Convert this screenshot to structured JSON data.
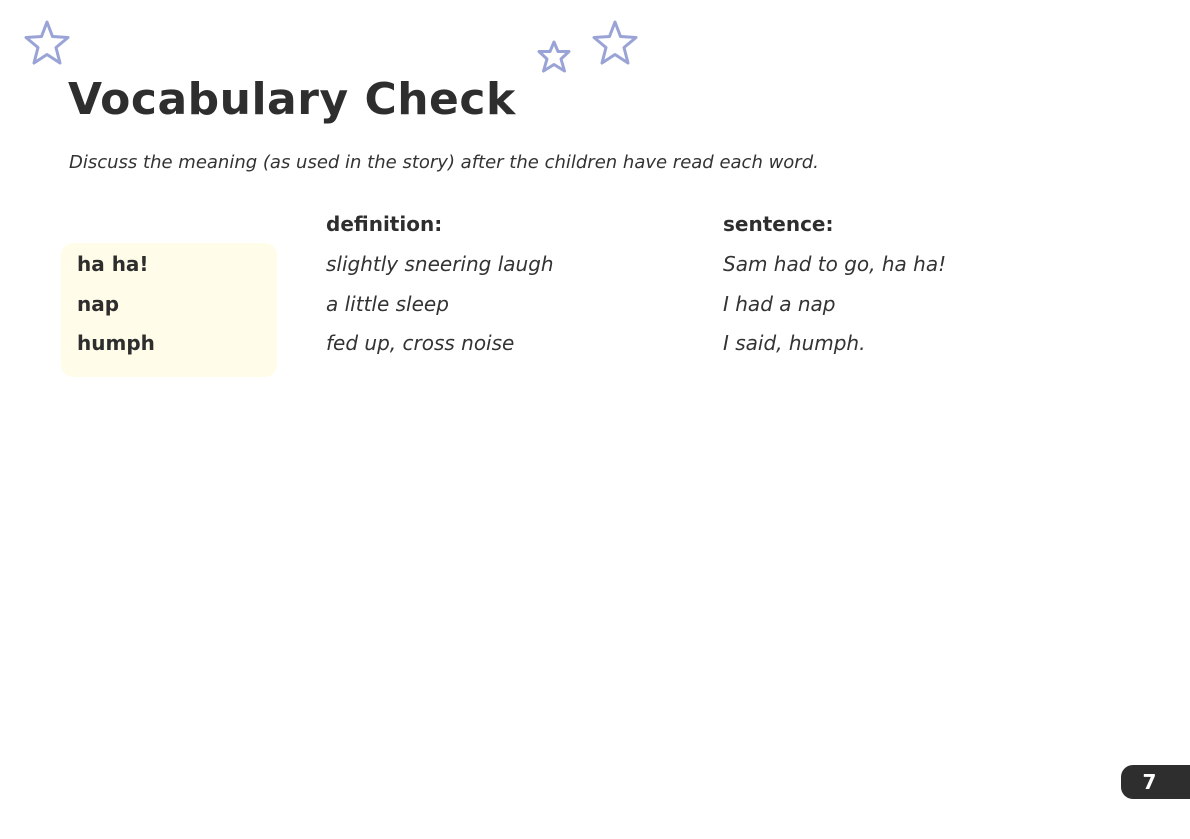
{
  "decorations": {
    "stars": [
      "star-icon",
      "star-icon",
      "star-icon"
    ],
    "star_color": "#9aa3d6"
  },
  "page": {
    "title": "Vocabulary Check",
    "instructions": "Discuss the meaning (as used in the story) after the children have read each word.",
    "page_number": "7"
  },
  "table": {
    "headers": {
      "definition": "definition:",
      "sentence": "sentence:"
    },
    "rows": [
      {
        "word": "ha ha!",
        "definition": "slightly sneering laugh",
        "sentence": "Sam had to go, ha ha!"
      },
      {
        "word": "nap",
        "definition": "a little sleep",
        "sentence": "I had a nap"
      },
      {
        "word": "humph",
        "definition": "fed up, cross noise",
        "sentence": "I said, humph."
      }
    ],
    "word_panel_color": "#fffde9"
  },
  "colors": {
    "text": "#2e2e2e",
    "page_tab": "#2e2e2e"
  }
}
